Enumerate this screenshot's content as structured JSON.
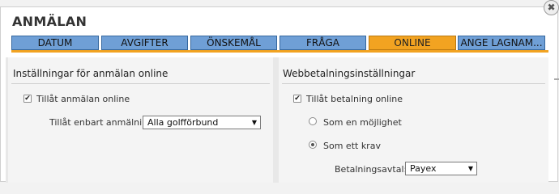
{
  "dialog": {
    "title": "ANMÄLAN",
    "close_symbol": "✖"
  },
  "tabs": [
    {
      "label": "DATUM"
    },
    {
      "label": "AVGIFTER"
    },
    {
      "label": "ÖNSKEMÅL"
    },
    {
      "label": "FRÅGA"
    },
    {
      "label": "ONLINE",
      "active": true
    },
    {
      "label": "ANGE LAGNAM..."
    }
  ],
  "left_panel": {
    "title": "Inställningar för anmälan online",
    "allow_online_label": "Tillåt anmälan online",
    "allow_online_checked": true,
    "restrict_label": "Tillåt enbart anmälni...",
    "restrict_value": "Alla golfförbund"
  },
  "right_panel": {
    "title": "Webbetalningsinställningar",
    "allow_payment_label": "Tillåt betalning online",
    "allow_payment_checked": true,
    "option_possibility_label": "Som en möjlighet",
    "option_requirement_label": "Som ett krav",
    "selected_option": "Som ett krav",
    "agreement_label": "Betalningsavtal:",
    "agreement_value": "Payex"
  },
  "colors": {
    "tab_inactive": "#6f9fd6",
    "tab_active": "#f2a321"
  }
}
